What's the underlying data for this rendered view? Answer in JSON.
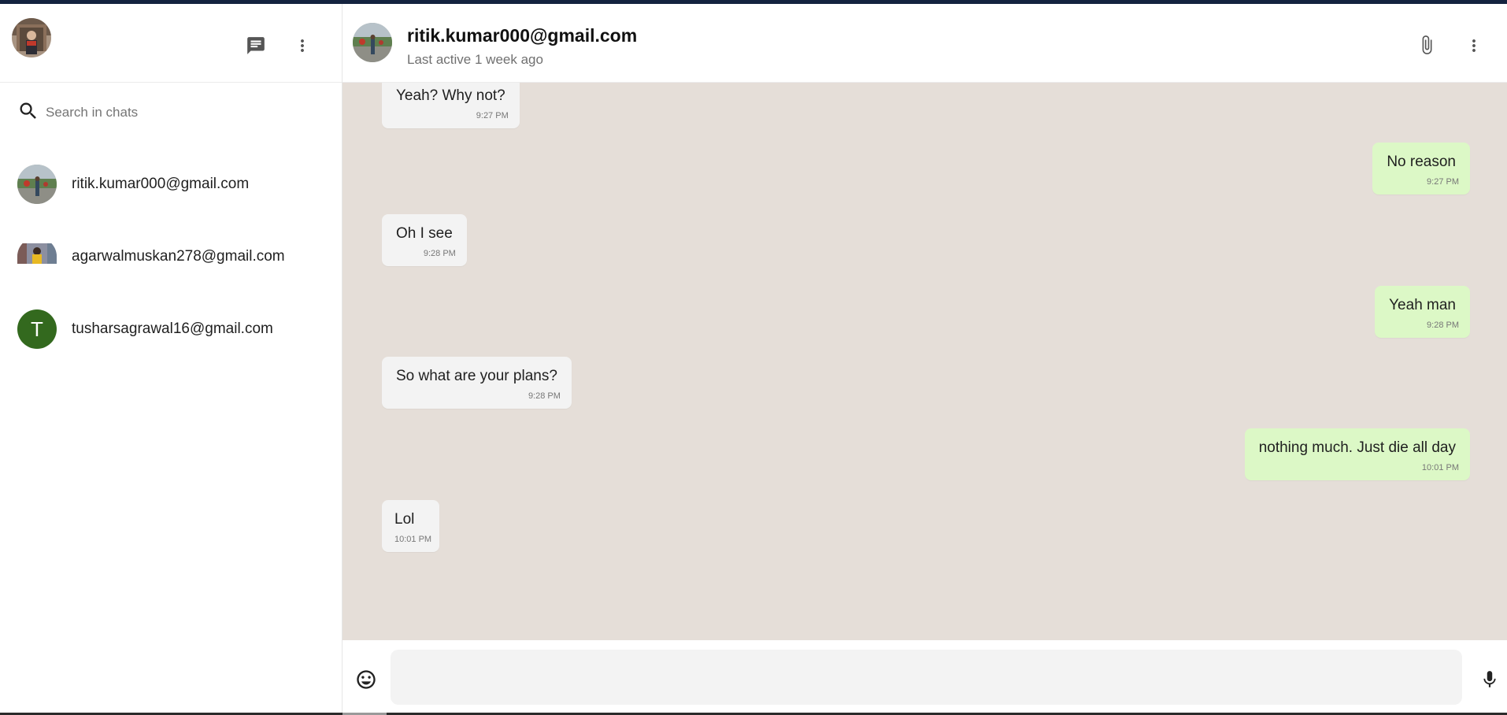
{
  "sidebar": {
    "search_placeholder": "Search in chats",
    "chats": [
      {
        "name": "ritik.kumar000@gmail.com"
      },
      {
        "name": "agarwalmuskan278@gmail.com"
      },
      {
        "name": "tusharsagrawal16@gmail.com",
        "initial": "T"
      }
    ]
  },
  "header": {
    "title": "ritik.kumar000@gmail.com",
    "status": "Last active 1 week ago"
  },
  "messages": [
    {
      "direction": "received",
      "text": "Yeah? Why not?",
      "time": "9:27 PM"
    },
    {
      "direction": "sent",
      "text": "No reason",
      "time": "9:27 PM"
    },
    {
      "direction": "received",
      "text": "Oh I see",
      "time": "9:28 PM"
    },
    {
      "direction": "sent",
      "text": "Yeah man",
      "time": "9:28 PM"
    },
    {
      "direction": "received",
      "text": "So what are your plans?",
      "time": "9:28 PM"
    },
    {
      "direction": "sent",
      "text": "nothing much. Just die all day",
      "time": "10:01 PM"
    },
    {
      "direction": "received",
      "text": "Lol",
      "time": "10:01 PM"
    }
  ],
  "composer": {
    "value": ""
  },
  "colors": {
    "chat_background": "#e5ded8",
    "sent_bubble": "#dcf8c6",
    "received_bubble": "#f3f3f3",
    "letter_avatar": "#33691e"
  },
  "icons": {
    "new_chat": "chat-icon",
    "sidebar_menu": "more-vert-icon",
    "search": "search-icon",
    "attach": "paperclip-icon",
    "header_menu": "more-vert-icon",
    "emoji": "emoji-icon",
    "mic": "mic-icon"
  }
}
